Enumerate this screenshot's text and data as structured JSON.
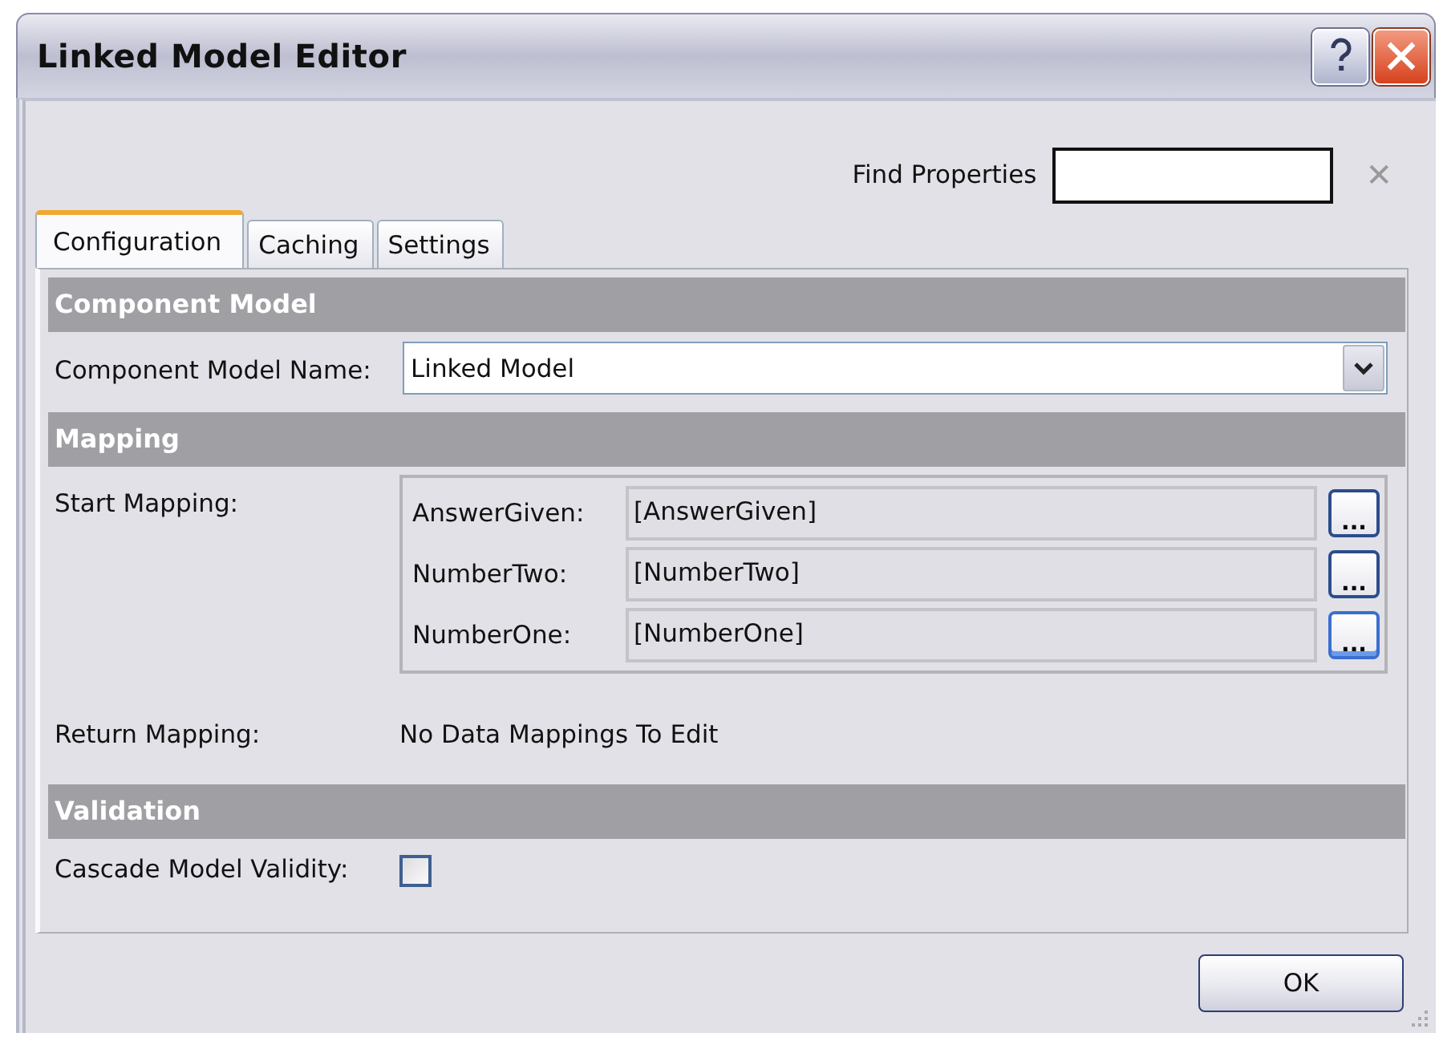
{
  "window": {
    "title": "Linked Model Editor"
  },
  "search": {
    "label": "Find Properties",
    "clear": "✕"
  },
  "tabs": [
    {
      "label": "Configuration",
      "selected": true
    },
    {
      "label": "Caching",
      "selected": false
    },
    {
      "label": "Settings",
      "selected": false
    }
  ],
  "sections": [
    {
      "title": "Component Model",
      "fields": [
        {
          "kind": "dropdown",
          "label": "Component Model Name:",
          "value": "Linked Model"
        }
      ]
    },
    {
      "title": "Mapping",
      "fields": [
        {
          "kind": "mapping",
          "label": "Start Mapping:",
          "mappings": [
            {
              "name": "AnswerGiven:",
              "value": "[AnswerGiven]",
              "browse": "...",
              "focused": false
            },
            {
              "name": "NumberTwo:",
              "value": "[NumberTwo]",
              "browse": "...",
              "focused": false
            },
            {
              "name": "NumberOne:",
              "value": "[NumberOne]",
              "browse": "...",
              "focused": true
            }
          ]
        },
        {
          "kind": "text",
          "label": "Return Mapping:",
          "value": "No Data Mappings To Edit"
        }
      ]
    },
    {
      "title": "Validation",
      "fields": [
        {
          "kind": "checkbox",
          "label": "Cascade Model Validity:",
          "checked": false
        }
      ]
    }
  ],
  "buttons": [
    "OK"
  ]
}
